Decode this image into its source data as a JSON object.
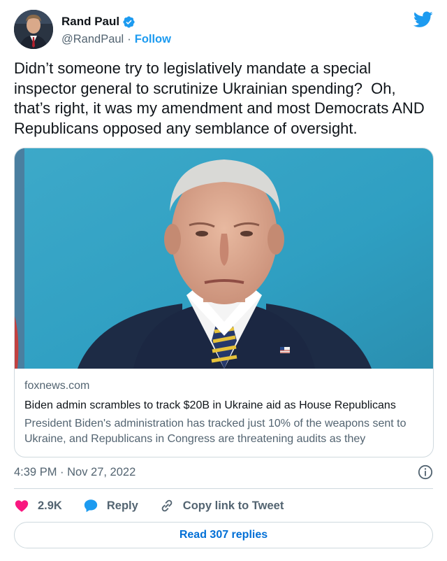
{
  "author": {
    "name": "Rand Paul",
    "handle": "@RandPaul",
    "separator": "·",
    "follow_label": "Follow",
    "verified_icon": "verified-badge-icon"
  },
  "tweet_text": "Didn’t someone try to legislatively mandate a special inspector general to scrutinize Ukrainian spending?  Oh, that’s right, it was my amendment and most Democrats AND Republicans opposed any semblance of oversight.",
  "card": {
    "domain": "foxnews.com",
    "title": "Biden admin scrambles to track $20B in Ukraine aid as House Republicans",
    "description": "President Biden's administration has tracked just 10% of the weapons sent to Ukraine, and Republicans in Congress are threatening audits as they"
  },
  "timestamp": "4:39 PM · Nov 27, 2022",
  "actions": {
    "likes": "2.9K",
    "reply_label": "Reply",
    "copy_label": "Copy link to Tweet"
  },
  "read_replies_label": "Read 307 replies",
  "colors": {
    "accent": "#1d9bf0",
    "like": "#f91880",
    "link": "#006fd6",
    "muted": "#536471",
    "border": "#cfd9de"
  }
}
